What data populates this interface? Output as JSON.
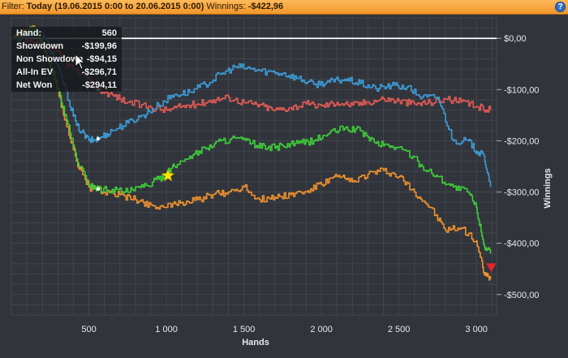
{
  "filter_bar": {
    "filter_label": "Filter: ",
    "filter_value": "Today (19.06.2015 0:00 to 20.06.2015 0:00)",
    "winnings_label": "Winnings: ",
    "winnings_value": "-$422,96",
    "help_icon": "?"
  },
  "tooltip": {
    "rows": [
      {
        "label": "Hand:",
        "value": "560"
      },
      {
        "label": "Showdown",
        "value": "-$199,96"
      },
      {
        "label": "Non Showdown",
        "value": "-$94,15"
      },
      {
        "label": "All-In EV",
        "value": "-$296,71"
      },
      {
        "label": "Net Won",
        "value": "-$294,11"
      }
    ]
  },
  "chart_data": {
    "type": "line",
    "xlabel": "Hands",
    "ylabel": "Winnings",
    "xlim": [
      0,
      3130
    ],
    "ylim": [
      -540,
      40
    ],
    "x_ticks": [
      500,
      1000,
      1500,
      2000,
      2500,
      3000
    ],
    "x_tick_labels": [
      "500",
      "1 000",
      "1 500",
      "2 000",
      "2 500",
      "3 000"
    ],
    "y_ticks": [
      0,
      -100,
      -200,
      -300,
      -400,
      -500
    ],
    "y_tick_labels": [
      "$0,00",
      "-$100,00",
      "-$200,00",
      "-$300,00",
      "-$400,00",
      "-$500,00"
    ],
    "grid": true,
    "colors": {
      "background": "#31353b",
      "grid": "#41454c",
      "zero_line": "#ffffff",
      "text": "#e8e8e8"
    },
    "series": [
      {
        "name": "Showdown",
        "color": "#e25a55",
        "points": [
          [
            0,
            0
          ],
          [
            150,
            -10
          ],
          [
            280,
            -25
          ],
          [
            400,
            -60
          ],
          [
            560,
            -100
          ],
          [
            650,
            -110
          ],
          [
            750,
            -125
          ],
          [
            900,
            -135
          ],
          [
            1000,
            -140
          ],
          [
            1100,
            -133
          ],
          [
            1200,
            -128
          ],
          [
            1300,
            -120
          ],
          [
            1400,
            -115
          ],
          [
            1500,
            -125
          ],
          [
            1600,
            -130
          ],
          [
            1700,
            -140
          ],
          [
            1800,
            -135
          ],
          [
            1900,
            -128
          ],
          [
            2000,
            -132
          ],
          [
            2100,
            -125
          ],
          [
            2200,
            -130
          ],
          [
            2300,
            -124
          ],
          [
            2400,
            -118
          ],
          [
            2500,
            -122
          ],
          [
            2600,
            -128
          ],
          [
            2700,
            -125
          ],
          [
            2800,
            -118
          ],
          [
            2900,
            -124
          ],
          [
            3000,
            -133
          ],
          [
            3090,
            -140
          ]
        ]
      },
      {
        "name": "Non Showdown",
        "color": "#3d9bd6",
        "points": [
          [
            0,
            0
          ],
          [
            200,
            10
          ],
          [
            280,
            -40
          ],
          [
            350,
            -100
          ],
          [
            420,
            -170
          ],
          [
            500,
            -200
          ],
          [
            560,
            -196
          ],
          [
            650,
            -180
          ],
          [
            750,
            -165
          ],
          [
            850,
            -150
          ],
          [
            950,
            -130
          ],
          [
            1050,
            -110
          ],
          [
            1150,
            -105
          ],
          [
            1250,
            -90
          ],
          [
            1350,
            -70
          ],
          [
            1450,
            -55
          ],
          [
            1550,
            -60
          ],
          [
            1650,
            -65
          ],
          [
            1750,
            -68
          ],
          [
            1850,
            -78
          ],
          [
            1950,
            -90
          ],
          [
            2050,
            -85
          ],
          [
            2150,
            -80
          ],
          [
            2250,
            -88
          ],
          [
            2350,
            -98
          ],
          [
            2450,
            -92
          ],
          [
            2550,
            -95
          ],
          [
            2650,
            -115
          ],
          [
            2750,
            -115
          ],
          [
            2850,
            -200
          ],
          [
            2950,
            -200
          ],
          [
            3000,
            -220
          ],
          [
            3050,
            -230
          ],
          [
            3090,
            -290
          ]
        ]
      },
      {
        "name": "All-In EV",
        "color": "#f0912d",
        "points": [
          [
            0,
            0
          ],
          [
            150,
            20
          ],
          [
            280,
            -80
          ],
          [
            350,
            -160
          ],
          [
            420,
            -240
          ],
          [
            500,
            -290
          ],
          [
            600,
            -300
          ],
          [
            700,
            -305
          ],
          [
            800,
            -315
          ],
          [
            900,
            -325
          ],
          [
            1000,
            -330
          ],
          [
            1100,
            -320
          ],
          [
            1200,
            -315
          ],
          [
            1300,
            -305
          ],
          [
            1400,
            -300
          ],
          [
            1500,
            -290
          ],
          [
            1600,
            -315
          ],
          [
            1700,
            -310
          ],
          [
            1800,
            -305
          ],
          [
            1900,
            -300
          ],
          [
            2000,
            -285
          ],
          [
            2100,
            -270
          ],
          [
            2200,
            -280
          ],
          [
            2300,
            -265
          ],
          [
            2400,
            -258
          ],
          [
            2500,
            -270
          ],
          [
            2600,
            -300
          ],
          [
            2700,
            -330
          ],
          [
            2800,
            -375
          ],
          [
            2900,
            -370
          ],
          [
            3000,
            -395
          ],
          [
            3050,
            -460
          ],
          [
            3090,
            -470
          ]
        ]
      },
      {
        "name": "Net Won",
        "color": "#3fcc3a",
        "points": [
          [
            0,
            0
          ],
          [
            150,
            20
          ],
          [
            280,
            -80
          ],
          [
            350,
            -150
          ],
          [
            420,
            -235
          ],
          [
            500,
            -285
          ],
          [
            560,
            -294
          ],
          [
            650,
            -295
          ],
          [
            750,
            -300
          ],
          [
            850,
            -290
          ],
          [
            950,
            -275
          ],
          [
            1000,
            -265
          ],
          [
            1050,
            -250
          ],
          [
            1150,
            -230
          ],
          [
            1250,
            -215
          ],
          [
            1350,
            -200
          ],
          [
            1450,
            -195
          ],
          [
            1550,
            -205
          ],
          [
            1650,
            -215
          ],
          [
            1750,
            -210
          ],
          [
            1850,
            -205
          ],
          [
            1950,
            -200
          ],
          [
            2050,
            -185
          ],
          [
            2150,
            -175
          ],
          [
            2250,
            -180
          ],
          [
            2350,
            -205
          ],
          [
            2450,
            -210
          ],
          [
            2550,
            -220
          ],
          [
            2650,
            -250
          ],
          [
            2750,
            -270
          ],
          [
            2850,
            -290
          ],
          [
            2950,
            -300
          ],
          [
            3000,
            -330
          ],
          [
            3050,
            -405
          ],
          [
            3090,
            -420
          ]
        ]
      }
    ],
    "markers": [
      {
        "name": "start-point-red",
        "x": 560,
        "y": -100,
        "color": "#ffffff",
        "shape": "circle"
      },
      {
        "name": "start-point-blue",
        "x": 560,
        "y": -196,
        "color": "#ffffff",
        "shape": "circle"
      },
      {
        "name": "start-point-green",
        "x": 560,
        "y": -294,
        "color": "#ffffff",
        "shape": "circle"
      },
      {
        "name": "star-marker",
        "x": 1010,
        "y": -268,
        "color": "#ffe600",
        "shape": "star"
      },
      {
        "name": "end-triangle-marker",
        "x": 3095,
        "y": -447,
        "color": "#e8232a",
        "shape": "triangle-down"
      }
    ]
  }
}
